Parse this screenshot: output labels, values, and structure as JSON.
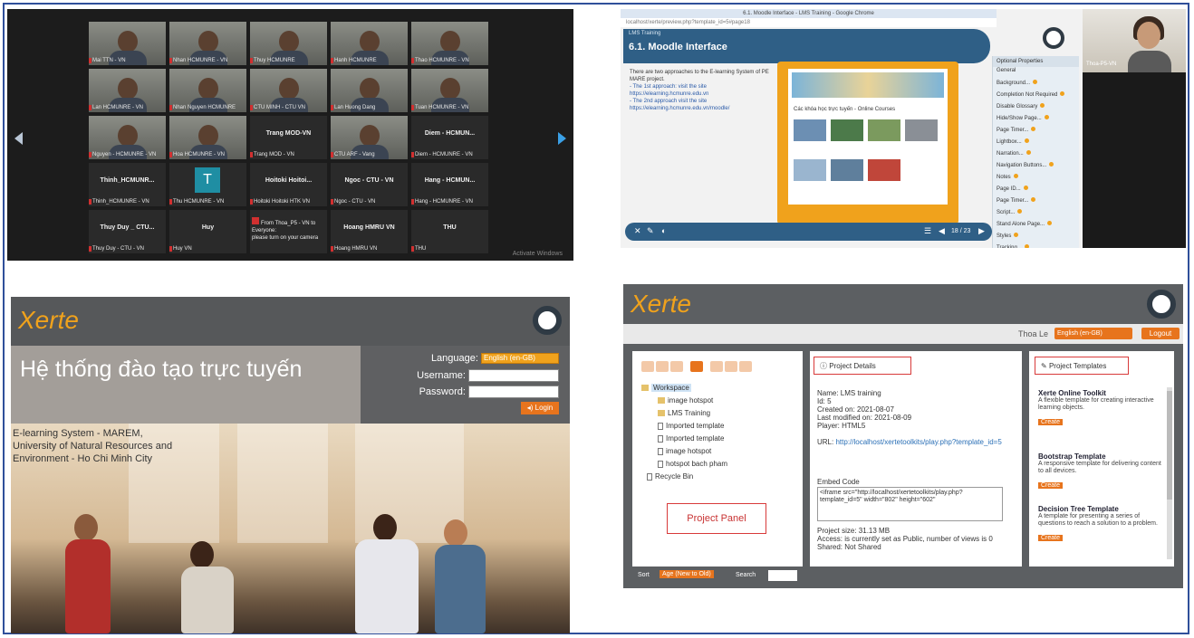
{
  "video_call": {
    "participants": [
      {
        "name": "Mai TTN - VN",
        "type": "video"
      },
      {
        "name": "Nhan HCMUNRE - VN",
        "type": "video"
      },
      {
        "name": "Thuy HCMUNRE",
        "type": "video"
      },
      {
        "name": "Hanh HCMUNRE",
        "type": "video"
      },
      {
        "name": "Thao HCMUNRE - VN",
        "type": "video"
      },
      {
        "name": "Lan HCMUNRE - VN",
        "type": "video"
      },
      {
        "name": "Nhan Nguyen HCMUNRE",
        "type": "video"
      },
      {
        "name": "CTU MINH - CTU VN",
        "type": "video"
      },
      {
        "name": "Lan Huong Dang",
        "type": "video"
      },
      {
        "name": "Tuan HCMUNRE - VN",
        "type": "video"
      },
      {
        "name": "Nguyen - HCMUNRE - VN",
        "type": "video"
      },
      {
        "name": "Hoa HCMUNRE - VN",
        "type": "video"
      },
      {
        "name": "Trang MOD - VN",
        "label": "Trang MOD-VN",
        "type": "name"
      },
      {
        "name": "CTU ARF - Vang",
        "type": "video"
      },
      {
        "name": "Diem - HCMUNRE - VN",
        "label": "Diem - HCMUN...",
        "type": "name"
      },
      {
        "name": "Thinh_HCMUNRE - VN",
        "label": "Thinh_HCMUNR...",
        "type": "name"
      },
      {
        "name": "Thu HCMUNRE - VN",
        "label": "T",
        "type": "avatar"
      },
      {
        "name": "Hoitoki Hoitoki HTK VN",
        "label": "Hoitoki Hoitoi...",
        "type": "name"
      },
      {
        "name": "Ngoc - CTU - VN",
        "label": "Ngoc - CTU - VN",
        "type": "name"
      },
      {
        "name": "Hang - HCMUNRE - VN",
        "label": "Hang - HCMUN...",
        "type": "name"
      },
      {
        "name": "Thuy Duy - CTU - VN",
        "label": "Thuy Duy _ CTU...",
        "type": "name"
      },
      {
        "name": "Huy VN",
        "label": "Huy",
        "type": "name"
      },
      {
        "name": "",
        "label": "",
        "type": "chat",
        "chat_from": "From Thoa_P5 - VN to Everyone:",
        "chat_msg": "please turn on your camera"
      },
      {
        "name": "Hoang HMRU VN",
        "label": "Hoang HMRU VN",
        "type": "name"
      },
      {
        "name": "THU",
        "label": "THU",
        "type": "name"
      }
    ],
    "watermark": "Activate Windows"
  },
  "moodle": {
    "window_title": "6.1. Moodle Interface - LMS Training - Google Chrome",
    "url": "localhost/xerte/preview.php?template_id=5#page18",
    "slide_subtitle": "LMS Training",
    "slide_title": "6.1. Moodle Interface",
    "slide_text": [
      "There are two approaches to the E-learning System of PE MARE project.",
      "- The 1st approach: visit the site https://elearning.hcmunre.edu.vn",
      "- The 2nd approach visit the site https://elearning.hcmunre.edu.vn/moodle/"
    ],
    "screenshot_caption": "Các khóa học trực tuyến - Online Courses",
    "toolbar_page": "18 / 23",
    "panel_title": "Optional Properties",
    "panel_group": "General",
    "properties": [
      "Background...",
      "Completion Not Required",
      "Disable Glossary",
      "Hide/Show Page...",
      "Page Timer...",
      "Lightbox...",
      "Narration...",
      "Navigation Buttons...",
      "Notes",
      "Page ID...",
      "Page Timer...",
      "Script...",
      "Stand Alone Page...",
      "Styles",
      "Tracking..."
    ],
    "cam_name": "Thoa-P5-VN"
  },
  "xerte_login": {
    "logo": "Xerte",
    "title": "Hệ thống đào tạo trực tuyến",
    "language_label": "Language:",
    "language_value": "English (en-GB)",
    "username_label": "Username:",
    "password_label": "Password:",
    "login_button": "Login",
    "description": "E-learning System - MAREM, University of Natural Resources and Environment - Ho Chi Minh City"
  },
  "xerte_workspace": {
    "logo": "Xerte",
    "user": "Thoa Le",
    "language": "English (en-GB)",
    "logout": "Logout",
    "tree": {
      "root": "Workspace",
      "items": [
        "image hotspot",
        "LMS Training",
        "Imported template",
        "Imported template",
        "image hotspot",
        "hotspot bach pham"
      ],
      "recycle": "Recycle Bin"
    },
    "project_panel_label": "Project Panel",
    "project_details_title": "Project Details",
    "details": {
      "name": "Name: LMS training",
      "id": "Id: 5",
      "created": "Created on: 2021-08-07",
      "modified": "Last modified on: 2021-08-09",
      "player": "Player: HTML5",
      "url_label": "URL:",
      "url": "http://localhost/xertetoolkits/play.php?template_id=5",
      "embed_label": "Embed Code",
      "embed_code": "<iframe src=\"http://localhost/xertetoolkits/play.php?template_id=5\" width=\"802\" height=\"602\"",
      "size": "Project size: 31.13 MB",
      "access": "Access: is currently set as Public, number of views is 0",
      "shared": "Shared: Not Shared"
    },
    "templates_title": "Project Templates",
    "templates": [
      {
        "title": "Xerte Online Toolkit",
        "desc": "A flexible template for creating interactive learning objects.",
        "button": "Create"
      },
      {
        "title": "Bootstrap Template",
        "desc": "A responsive template for delivering content to all devices.",
        "button": "Create"
      },
      {
        "title": "Decision Tree Template",
        "desc": "A template for presenting a series of questions to reach a solution to a problem.",
        "button": "Create"
      }
    ],
    "sort_label": "Sort",
    "sort_value": "Age (New to Old)",
    "search_label": "Search"
  }
}
